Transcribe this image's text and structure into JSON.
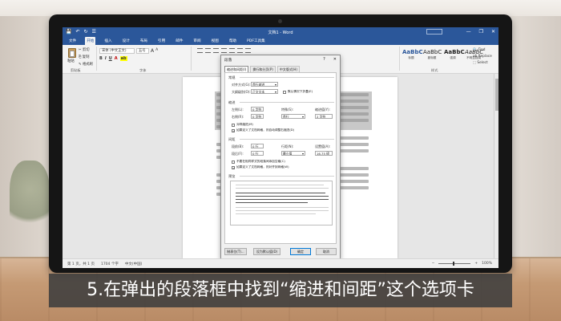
{
  "app": {
    "title": "文档1 - Word",
    "quick_access": [
      "💾",
      "↶",
      "↻",
      "☰"
    ],
    "window_controls": [
      "—",
      "❐",
      "✕"
    ]
  },
  "ribbon": {
    "tabs": [
      "文件",
      "开始",
      "插入",
      "设计",
      "布局",
      "引用",
      "邮件",
      "审阅",
      "视图",
      "帮助",
      "PDF工具集"
    ],
    "active_tab": "开始",
    "clipboard": {
      "paste": "粘贴",
      "cut": "✂ 剪切",
      "copy": "⎘ 复制",
      "format_painter": "✎ 格式刷",
      "group": "剪贴板"
    },
    "font": {
      "name": "宋体 (中文正文)",
      "size": "五号",
      "grow": "A",
      "shrink": "A",
      "bold": "B",
      "italic": "I",
      "underline": "U",
      "group": "字体"
    },
    "paragraph": {
      "group": "段落"
    },
    "styles": {
      "items": [
        {
          "sample": "AaBbC",
          "name": "标题"
        },
        {
          "sample": "AaBbC",
          "name": "副标题"
        },
        {
          "sample": "AaBbC",
          "name": "强调"
        },
        {
          "sample": "AaBbC",
          "name": "不明显强调"
        },
        {
          "sample": "AaBbCcI",
          "name": "正文"
        }
      ],
      "group": "样式"
    },
    "editing": {
      "find": "🔍 Find",
      "replace": "ab Replace",
      "select": "⬚ Select",
      "group": "编辑"
    }
  },
  "dialog": {
    "title": "段落",
    "help": "?",
    "close": "✕",
    "tabs": [
      "缩进和间距(I)",
      "换行和分页(P)",
      "中文版式(H)"
    ],
    "active_tab": "缩进和间距(I)",
    "general": {
      "section": "常规",
      "alignment_label": "对齐方式(G):",
      "alignment_value": "首行缩进",
      "outline_label": "大纲级别(O):",
      "outline_value": "正文文本",
      "collapsed_label": "默认情况下折叠(E)"
    },
    "indent": {
      "section": "缩进",
      "left_label": "左侧(L):",
      "left_value": "0 字符",
      "right_label": "右侧(R):",
      "right_value": "0 字符",
      "special_label": "特殊(S):",
      "special_value": "首行",
      "by_label": "缩进值(Y):",
      "by_value": "2 字符",
      "mirror_label": "对称缩进(M)",
      "auto_right_label": "如果定义了文档网格，则自动调整右缩进(D)"
    },
    "spacing": {
      "section": "间距",
      "before_label": "段前(B):",
      "before_value": "0 行",
      "after_label": "段后(F):",
      "after_value": "0 行",
      "line_label": "行距(N):",
      "line_value": "最小值",
      "at_label": "设置值(A):",
      "at_value": "16.75 磅",
      "no_space_label": "不要在相同样式的段落间添加空格(C)",
      "snap_label": "如果定义了文档网格，则对齐到网格(W)"
    },
    "preview": {
      "section": "预览"
    },
    "buttons": {
      "tabs": "制表位(T)...",
      "default": "设为默认值(D)",
      "ok": "确定",
      "cancel": "取消"
    }
  },
  "document": {
    "fragments": [
      "《党",
      "第二",
      "节目",
      "《党",
      "发展",
      "中共",
      "别反",
      "国共",
      "事任",
      "年大"
    ]
  },
  "statusbar": {
    "page": "第 1 页，共 1 页",
    "words": "1704 个字",
    "lang": "中文(中国)",
    "zoom": "100%",
    "minus": "−",
    "plus": "+"
  },
  "caption": "5.在弹出的段落框中找到“缩进和间距”这个选项卡"
}
